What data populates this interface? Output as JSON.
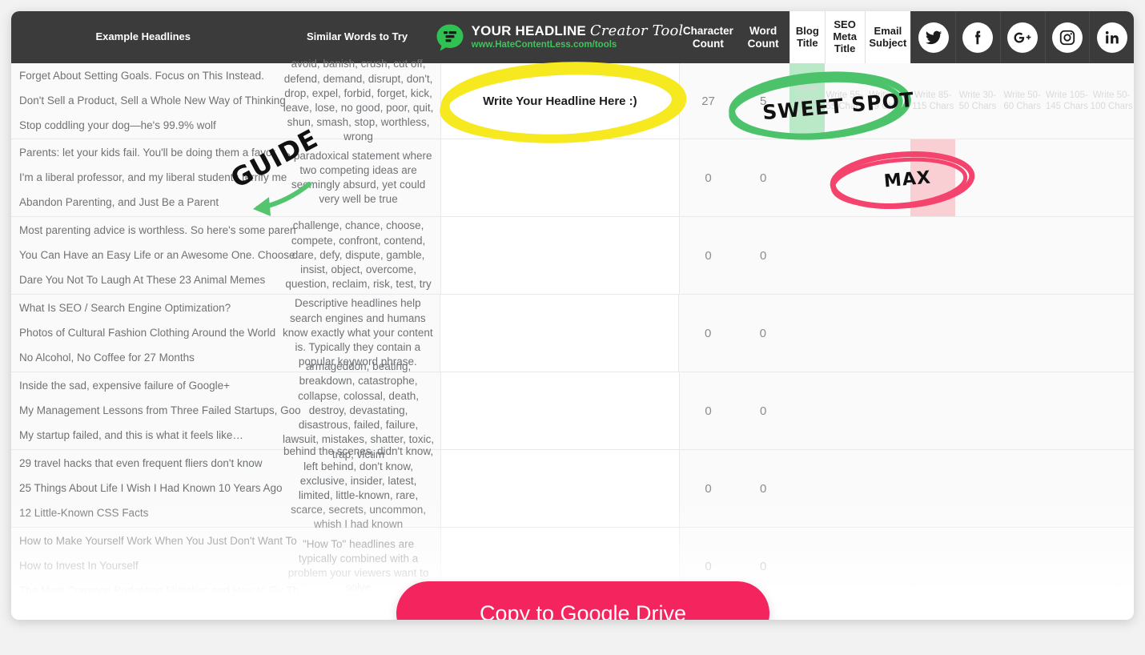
{
  "brand": {
    "logo_line1_bold": "YOUR HEADLINE",
    "logo_line1_script": "Creator Tool",
    "logo_url": "www.HateContentLess.com/tools",
    "green": "#3ec45c",
    "accent_pink": "#f4245e"
  },
  "header": {
    "col_examples": "Example Headlines",
    "col_similar": "Similar Words to Try",
    "col_char_count": "Character Count",
    "col_word_count": "Word Count",
    "tab_blog": "Blog Title",
    "tab_seo": "SEO Meta Title",
    "tab_email": "Email Subject",
    "social": [
      {
        "name": "twitter",
        "label": "Twitter"
      },
      {
        "name": "facebook",
        "label": "Facebook"
      },
      {
        "name": "googleplus",
        "label": "Google+"
      },
      {
        "name": "instagram",
        "label": "Instagram"
      },
      {
        "name": "linkedin",
        "label": "LinkedIn"
      }
    ]
  },
  "input": {
    "headline_value": "Write Your Headline Here :)"
  },
  "annotations": [
    {
      "name": "guide",
      "text": "GUIDE",
      "color": "#2e2e2e",
      "arrow_color": "#54c46e"
    },
    {
      "name": "sweet-spot",
      "text": "SWEET SPOT",
      "color": "#2e2e2e",
      "circle_color": "#4cc26a"
    },
    {
      "name": "max",
      "text": "MAX",
      "color": "#2e2e2e",
      "circle_color": "#f4446e"
    },
    {
      "name": "headline-input-circle",
      "text": "",
      "circle_color": "#f7e920"
    }
  ],
  "cta": {
    "label": "Copy to Google Drive"
  },
  "rows": [
    {
      "examples": [
        "Forget About Setting Goals. Focus on This Instead.",
        "Don't Sell a Product, Sell a Whole New Way of Thinking",
        "Stop coddling your dog—he's 99.9% wolf"
      ],
      "similar": "avoid, banish, crush, cut off, defend, demand, disrupt, don't, drop, expel, forbid, forget, kick, leave, lose, no good, poor, quit, shun, smash, stop, worthless, wrong",
      "char_count": "27",
      "word_count": "5",
      "hints": [
        "Write 40-50 Chars",
        "Write 55-65 Chars",
        "Write 28-39 Chars",
        "Write 85-115 Chars",
        "Write 30-50 Chars",
        "Write 50-60 Chars",
        "Write 105-145 Chars",
        "Write 50-100 Chars"
      ]
    },
    {
      "examples": [
        "Parents: let your kids fail. You'll be doing them a favor",
        "I'm a liberal professor, and my liberal students terrify me",
        "Abandon Parenting, and Just Be a Parent"
      ],
      "similar": "a paradoxical statement where two competing ideas are seemingly absurd, yet could very well be true",
      "char_count": "0",
      "word_count": "0"
    },
    {
      "examples": [
        "Most parenting advice is worthless. So here's some paren",
        "You Can Have an Easy Life or an Awesome One. Choose",
        "Dare You Not To Laugh At These 23 Animal Memes"
      ],
      "similar": "challenge, chance, choose, compete, confront, contend, dare, defy, dispute, gamble, insist, object, overcome, question, reclaim, risk, test, try",
      "char_count": "0",
      "word_count": "0"
    },
    {
      "examples": [
        "What Is SEO / Search Engine Optimization?",
        "Photos of Cultural Fashion Clothing Around the World",
        "No Alcohol, No Coffee for 27 Months"
      ],
      "similar": "Descriptive headlines help search engines and humans know exactly what your content is. Typically they contain a popular keyword phrase.",
      "char_count": "0",
      "word_count": "0"
    },
    {
      "examples": [
        "Inside the sad, expensive failure of Google+",
        "My Management Lessons from Three Failed Startups, Goo",
        "My startup failed, and this is what it feels like…"
      ],
      "similar": "armageddon, beating, breakdown, catastrophe, collapse, colossal, death, destroy, devastating, disastrous, failed, failure, lawsuit, mistakes, shatter, toxic, trap, victim",
      "char_count": "0",
      "word_count": "0"
    },
    {
      "examples": [
        "29 travel hacks that even frequent fliers don't know",
        "25 Things About Life I Wish I Had Known 10 Years Ago",
        "12 Little-Known CSS Facts"
      ],
      "similar": "behind the scenes, didn't know, left behind, don't know, exclusive, insider, latest, limited, little-known, rare, scarce, secrets, uncommon, whish I had known",
      "char_count": "0",
      "word_count": "0"
    },
    {
      "examples": [
        "How to Make Yourself Work When You Just Don't Want To",
        "How to Invest In Yourself",
        "The Most Common Budgeting Mistakes and How to Fix Th"
      ],
      "similar": "\"How To\" headlines are typically combined with a problem your viewers want to solve",
      "char_count": "0",
      "word_count": "0"
    }
  ]
}
